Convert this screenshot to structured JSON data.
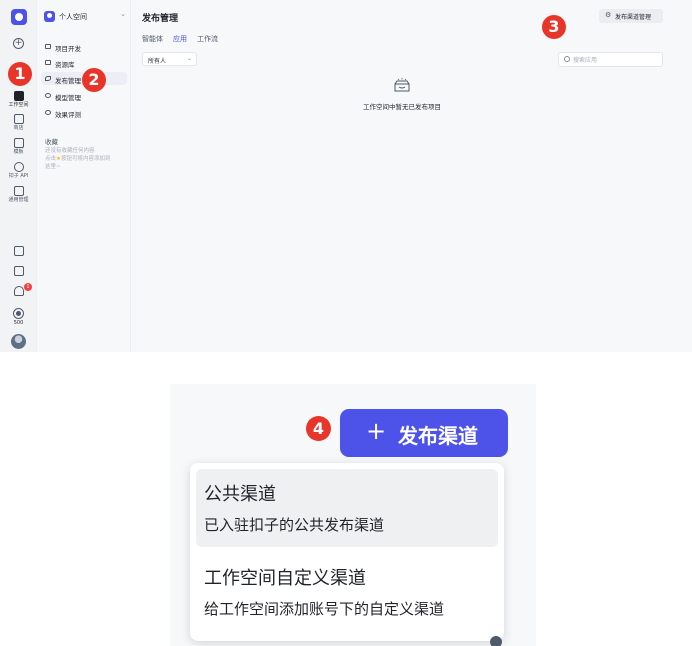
{
  "rail": {
    "items": [
      {
        "label": "工作空间"
      },
      {
        "label": "商店"
      },
      {
        "label": "模板"
      },
      {
        "label": "扣子 API"
      },
      {
        "label": "通用管理"
      }
    ],
    "notification_count": "1",
    "recording_label": "500"
  },
  "sidebar": {
    "space_name": "个人空间",
    "items": [
      {
        "label": "项目开发"
      },
      {
        "label": "资源库"
      },
      {
        "label": "发布管理"
      },
      {
        "label": "模型管理"
      },
      {
        "label": "效果评测"
      }
    ],
    "favorites_title": "收藏",
    "favorites_tip_1": "还没有收藏任何内容",
    "favorites_tip_2": "点击",
    "favorites_tip_3": "按钮可将内容添加到",
    "favorites_tip_4": "这里~"
  },
  "main": {
    "title": "发布管理",
    "tabs": [
      {
        "label": "智能体"
      },
      {
        "label": "应用"
      },
      {
        "label": "工作流"
      }
    ],
    "filter_value": "所有人",
    "channel_manage_label": "发布渠道管理",
    "search_placeholder": "搜索应用",
    "empty_text": "工作空间中暂无已发布项目"
  },
  "markers": [
    "1",
    "2",
    "3",
    "4"
  ],
  "zoom": {
    "publish_button_label": "发布渠道",
    "menu": [
      {
        "title": "公共渠道",
        "desc": "已入驻扣子的公共发布渠道"
      },
      {
        "title": "工作空间自定义渠道",
        "desc": "给工作空间添加账号下的自定义渠道"
      }
    ]
  },
  "colors": {
    "accent": "#4d53e8",
    "marker": "#e8352a"
  }
}
